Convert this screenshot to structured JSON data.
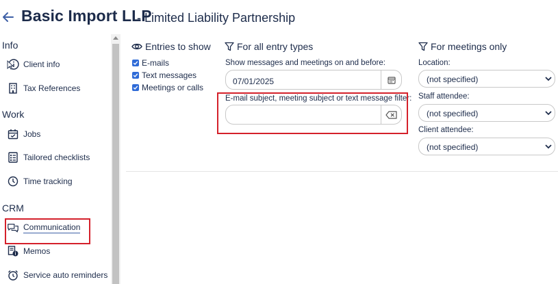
{
  "header": {
    "client_name": "Basic Import LLP",
    "client_type": "- Limited Liability Partnership"
  },
  "sidebar": {
    "sections": [
      {
        "heading": "Info",
        "items": [
          {
            "label": "Client info",
            "icon": "info-circle-icon"
          },
          {
            "label": "Tax References",
            "icon": "building-icon"
          }
        ]
      },
      {
        "heading": "Work",
        "items": [
          {
            "label": "Jobs",
            "icon": "calendar-icon"
          },
          {
            "label": "Tailored checklists",
            "icon": "checklist-icon"
          },
          {
            "label": "Time tracking",
            "icon": "clock-icon"
          }
        ]
      },
      {
        "heading": "CRM",
        "items": [
          {
            "label": "Communication",
            "icon": "chat-bubbles-icon",
            "active": true
          },
          {
            "label": "Memos",
            "icon": "memo-info-icon"
          },
          {
            "label": "Service auto reminders",
            "icon": "alarm-clock-icon"
          }
        ]
      }
    ]
  },
  "entries_to_show": {
    "heading": "Entries to show",
    "options": [
      {
        "label": "E-mails",
        "checked": true
      },
      {
        "label": "Text messages",
        "checked": true
      },
      {
        "label": "Meetings or calls",
        "checked": true
      }
    ]
  },
  "all_entry_types": {
    "heading": "For all entry types",
    "date_label": "Show messages and meetings on and before:",
    "date_value": "07/01/2025",
    "filter_label": "E-mail subject, meeting subject or text message filter:",
    "filter_value": ""
  },
  "meetings_only": {
    "heading": "For meetings only",
    "location_label": "Location:",
    "location_value": "(not specified)",
    "staff_label": "Staff attendee:",
    "staff_value": "(not specified)",
    "client_label": "Client attendee:",
    "client_value": "(not specified)"
  },
  "colors": {
    "accent": "#3d5fa6",
    "highlight_box": "#d4202a",
    "checkbox": "#2f6bd7",
    "text": "#1c2b4a"
  }
}
